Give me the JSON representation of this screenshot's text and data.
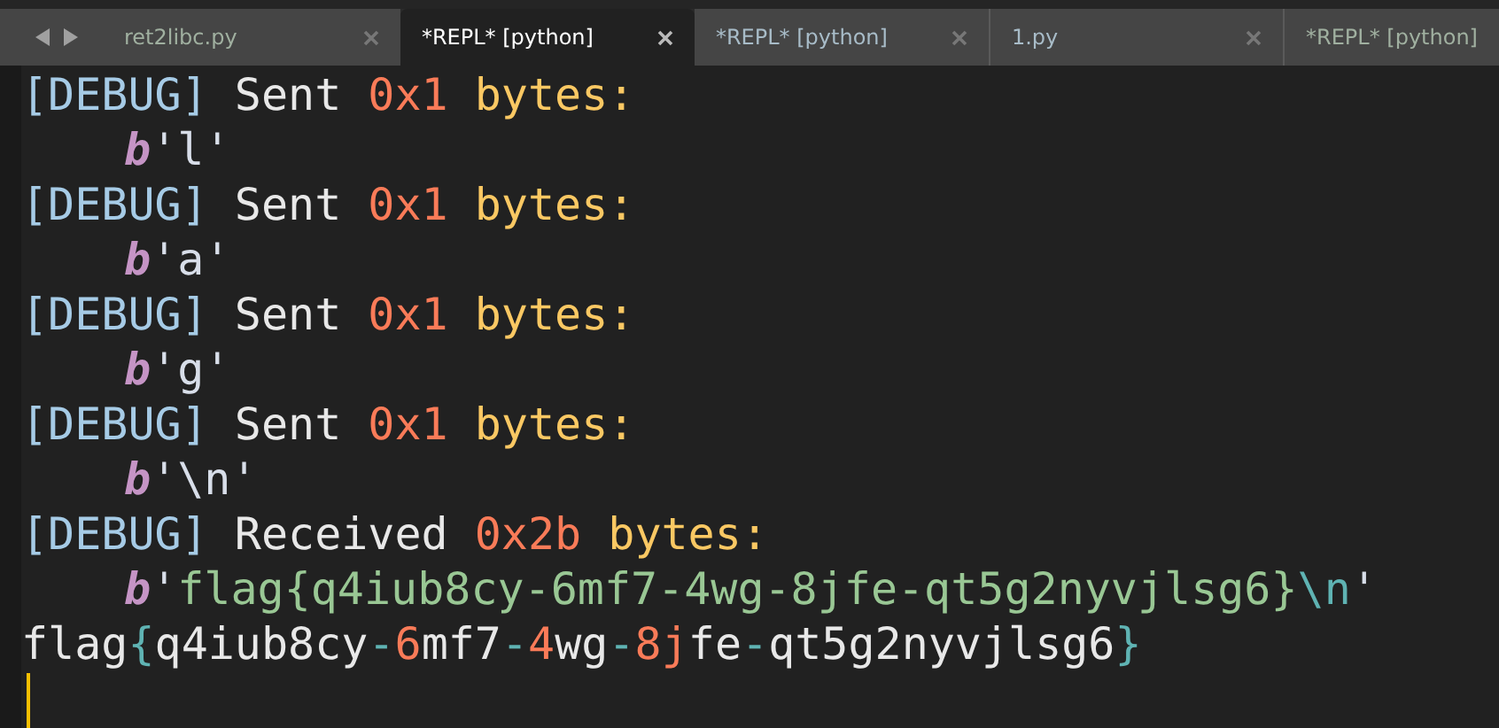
{
  "tabs": [
    {
      "label": "ret2libc.py",
      "selected": false,
      "closable": true
    },
    {
      "label": "*REPL* [python]",
      "selected": true,
      "closable": true
    },
    {
      "label": "*REPL* [python]",
      "selected": false,
      "closable": true
    },
    {
      "label": "1.py",
      "selected": false,
      "closable": true
    },
    {
      "label": "*REPL* [python]",
      "selected": false,
      "closable": false
    }
  ],
  "lines": [
    {
      "kind": "log",
      "segments": [
        {
          "kind": "tag",
          "text": "[DEBUG]"
        },
        {
          "kind": "plain",
          "text": " Sent "
        },
        {
          "kind": "number",
          "text": "0x1"
        },
        {
          "kind": "word",
          "text": " bytes:"
        }
      ]
    },
    {
      "kind": "bytes",
      "segments": [
        {
          "kind": "prefix",
          "text": "b"
        },
        {
          "kind": "quote",
          "text": "'l'"
        }
      ]
    },
    {
      "kind": "log",
      "segments": [
        {
          "kind": "tag",
          "text": "[DEBUG]"
        },
        {
          "kind": "plain",
          "text": " Sent "
        },
        {
          "kind": "number",
          "text": "0x1"
        },
        {
          "kind": "word",
          "text": " bytes:"
        }
      ]
    },
    {
      "kind": "bytes",
      "segments": [
        {
          "kind": "prefix",
          "text": "b"
        },
        {
          "kind": "quote",
          "text": "'a'"
        }
      ]
    },
    {
      "kind": "log",
      "segments": [
        {
          "kind": "tag",
          "text": "[DEBUG]"
        },
        {
          "kind": "plain",
          "text": " Sent "
        },
        {
          "kind": "number",
          "text": "0x1"
        },
        {
          "kind": "word",
          "text": " bytes:"
        }
      ]
    },
    {
      "kind": "bytes",
      "segments": [
        {
          "kind": "prefix",
          "text": "b"
        },
        {
          "kind": "quote",
          "text": "'g'"
        }
      ]
    },
    {
      "kind": "log",
      "segments": [
        {
          "kind": "tag",
          "text": "[DEBUG]"
        },
        {
          "kind": "plain",
          "text": " Sent "
        },
        {
          "kind": "number",
          "text": "0x1"
        },
        {
          "kind": "word",
          "text": " bytes:"
        }
      ]
    },
    {
      "kind": "bytes",
      "segments": [
        {
          "kind": "prefix",
          "text": "b"
        },
        {
          "kind": "quote",
          "text": "'\\n'"
        }
      ]
    },
    {
      "kind": "log",
      "segments": [
        {
          "kind": "tag",
          "text": "[DEBUG]"
        },
        {
          "kind": "plain",
          "text": " Received "
        },
        {
          "kind": "number",
          "text": "0x2b"
        },
        {
          "kind": "word",
          "text": " bytes:"
        }
      ]
    },
    {
      "kind": "bytes",
      "segments": [
        {
          "kind": "prefix",
          "text": "b"
        },
        {
          "kind": "quote",
          "text": "'"
        },
        {
          "kind": "string",
          "text": "flag{q4iub8cy-6mf7-4wg-8jfe-qt5g2nyvjlsg6}"
        },
        {
          "kind": "escape",
          "text": "\\n"
        },
        {
          "kind": "quote",
          "text": "'"
        }
      ]
    },
    {
      "kind": "output",
      "segments": [
        {
          "kind": "plain",
          "text": "flag"
        },
        {
          "kind": "escape",
          "text": "{"
        },
        {
          "kind": "plain",
          "text": "q4iub8cy"
        },
        {
          "kind": "escape",
          "text": "-"
        },
        {
          "kind": "number",
          "text": "6"
        },
        {
          "kind": "plain",
          "text": "mf7"
        },
        {
          "kind": "escape",
          "text": "-"
        },
        {
          "kind": "number",
          "text": "4"
        },
        {
          "kind": "plain",
          "text": "wg"
        },
        {
          "kind": "escape",
          "text": "-"
        },
        {
          "kind": "number",
          "text": "8j"
        },
        {
          "kind": "plain",
          "text": "fe"
        },
        {
          "kind": "escape",
          "text": "-"
        },
        {
          "kind": "plain",
          "text": "qt5g2nyvjlsg6"
        },
        {
          "kind": "escape",
          "text": "}"
        }
      ]
    }
  ]
}
